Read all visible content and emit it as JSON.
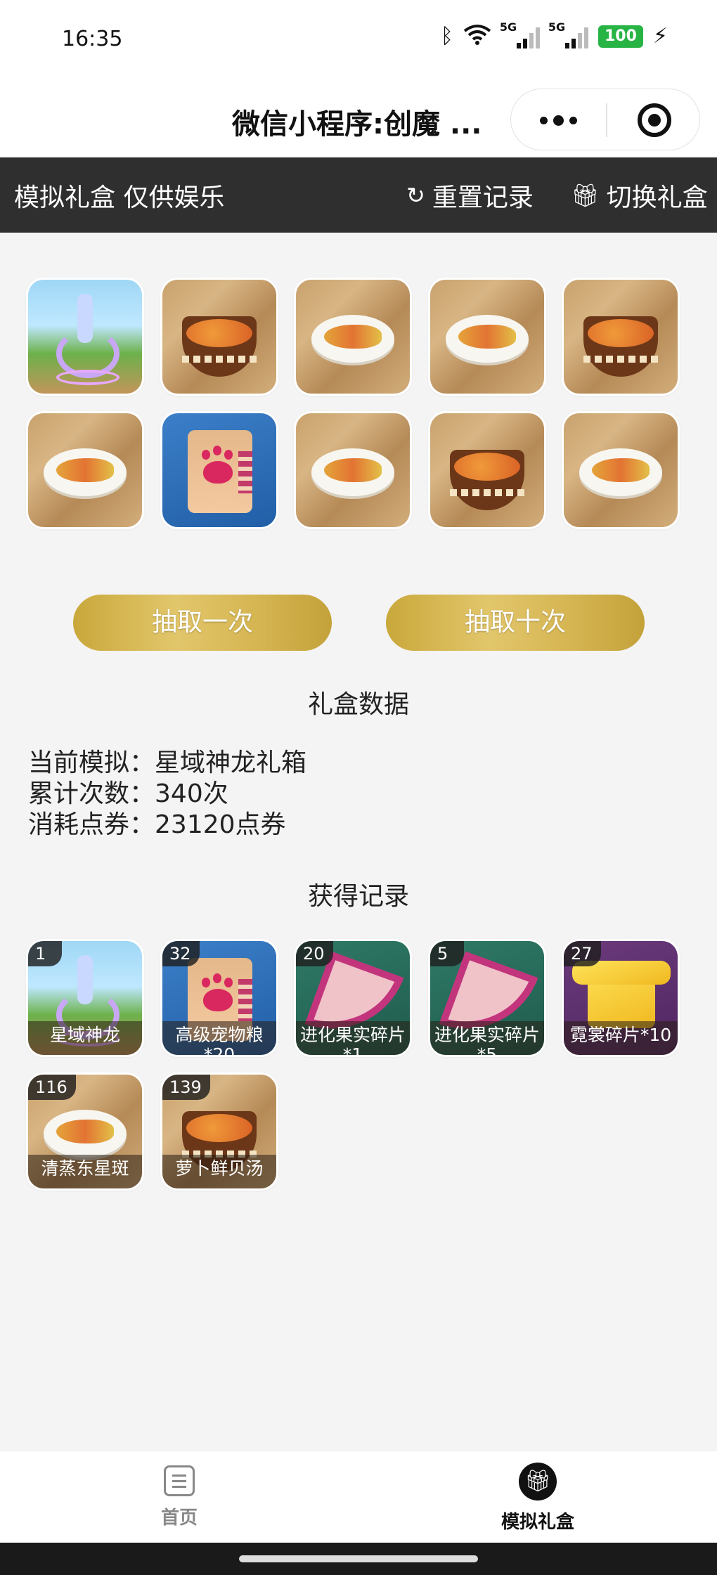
{
  "status_bar": {
    "time": "16:35",
    "network_1": "5G",
    "network_2": "5G",
    "battery": "100"
  },
  "nav": {
    "title": "微信小程序:创魔 ...",
    "more_icon": "more-dots-icon",
    "close_icon": "target-close-icon"
  },
  "toolbar": {
    "title": "模拟礼盒 仅供娱乐",
    "reset_label": "重置记录",
    "switch_label": "切换礼盒",
    "reset_icon": "refresh-icon",
    "switch_icon": "gift-icon"
  },
  "draw_results": [
    {
      "item": "dragon"
    },
    {
      "item": "soup"
    },
    {
      "item": "fish"
    },
    {
      "item": "fish"
    },
    {
      "item": "soup"
    },
    {
      "item": "fish"
    },
    {
      "item": "pet-food-bag"
    },
    {
      "item": "fish"
    },
    {
      "item": "soup"
    },
    {
      "item": "fish"
    }
  ],
  "buttons": {
    "draw_once": "抽取一次",
    "draw_ten": "抽取十次"
  },
  "stats": {
    "section_title": "礼盒数据",
    "current_label": "当前模拟：",
    "current_value": "星域神龙礼箱",
    "count_label": "累计次数：",
    "count_value": "340次",
    "cost_label": "消耗点券：",
    "cost_value": "23120点券"
  },
  "records": {
    "section_title": "获得记录",
    "items": [
      {
        "count": "1",
        "name": "星域神龙",
        "kind": "dragon"
      },
      {
        "count": "32",
        "name": "高级宠物粮*20",
        "kind": "pet-food-bag"
      },
      {
        "count": "20",
        "name": "进化果实碎片*1",
        "kind": "fruit"
      },
      {
        "count": "5",
        "name": "进化果实碎片*5",
        "kind": "fruit"
      },
      {
        "count": "27",
        "name": "霓裳碎片*10",
        "kind": "shirt"
      },
      {
        "count": "116",
        "name": "清蒸东星斑",
        "kind": "fish"
      },
      {
        "count": "139",
        "name": "萝卜鲜贝汤",
        "kind": "soup"
      }
    ]
  },
  "tabbar": {
    "home_label": "首页",
    "gift_label": "模拟礼盒"
  },
  "colors": {
    "toolbar_bg": "#2f2f2f",
    "button_gold": "#d6b653",
    "page_bg": "#f4f4f4"
  }
}
